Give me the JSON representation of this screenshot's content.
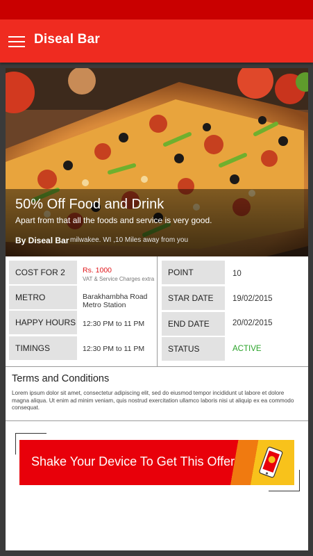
{
  "app": {
    "title": "Diseal Bar"
  },
  "hero": {
    "title": "50% Off Food and Drink",
    "subtitle": "Apart from that all the foods and service is very good.",
    "by": "By Diseal Bar",
    "location": "milwakee. WI ,10 Miles away from you"
  },
  "details": {
    "left": [
      {
        "label": "COST FOR 2",
        "value": "Rs. 1000",
        "note": "VAT & Service Charges extra"
      },
      {
        "label": "METRO",
        "value": "Barakhambha Road",
        "value2": "Metro Station"
      },
      {
        "label": "HAPPY HOURS",
        "value": "12:30 PM to 11 PM"
      },
      {
        "label": "TIMINGS",
        "value": "12:30 PM to 11 PM"
      }
    ],
    "right": [
      {
        "label": "POINT",
        "value": "10"
      },
      {
        "label": "STAR DATE",
        "value": "19/02/2015"
      },
      {
        "label": "END DATE",
        "value": "20/02/2015"
      },
      {
        "label": "STATUS",
        "value": "ACTIVE"
      }
    ]
  },
  "terms": {
    "title": "Terms and Conditions",
    "body": "Lorem ipsum dolor sit amet, consectetur adipiscing elit, sed do eiusmod tempor incididunt ut labore et dolore magna aliqua. Ut enim ad minim veniam, quis nostrud exercitation ullamco laboris nisi ut aliquip ex ea commodo consequat."
  },
  "offer": {
    "text": "Shake Your Device To Get This Offer",
    "icon": "phone-icon"
  },
  "colors": {
    "appbar": "#ef2b20",
    "statusbar": "#c90000",
    "price": "#e0161a",
    "active": "#2aa32a",
    "banner": "#e8000a"
  }
}
